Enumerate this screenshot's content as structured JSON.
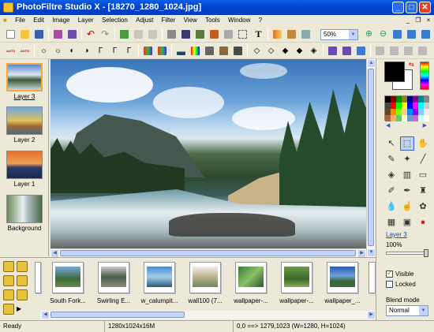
{
  "window": {
    "title": "PhotoFiltre Studio X - [18270_1280_1024.jpg]",
    "controls": {
      "minimize": "_",
      "maximize": "□",
      "close": "✕"
    }
  },
  "menu": [
    "File",
    "Edit",
    "Image",
    "Layer",
    "Selection",
    "Adjust",
    "Filter",
    "View",
    "Tools",
    "Window",
    "?"
  ],
  "toolbar": {
    "zoom_value": "50%",
    "text_tool_label": "T",
    "auto_labels": [
      "AUTO",
      "AUTO"
    ]
  },
  "layers_panel": {
    "items": [
      {
        "label": "Layer 3",
        "active": true
      },
      {
        "label": "Layer 2",
        "active": false
      },
      {
        "label": "Layer 1",
        "active": false
      },
      {
        "label": "Background",
        "active": false
      }
    ]
  },
  "image_canvas": {
    "subject": "mountain river landscape with pine forest"
  },
  "file_browser": {
    "items": [
      {
        "caption": "South Fork..."
      },
      {
        "caption": "Swirling E..."
      },
      {
        "caption": "w_calumpit..."
      },
      {
        "caption": "wall100 (7..."
      },
      {
        "caption": "wallpaper-..."
      },
      {
        "caption": "wallpaper-..."
      },
      {
        "caption": "wallpaper_..."
      }
    ]
  },
  "right_panel": {
    "layer_name": "Layer 3",
    "opacity": "100%",
    "visible_label": "Visible",
    "visible_checked": true,
    "locked_label": "Locked",
    "locked_checked": false,
    "blend_mode_label": "Blend mode",
    "blend_mode_value": "Normal"
  },
  "status": {
    "ready": "Ready",
    "size": "1280x1024x16M",
    "coords": "0,0 ==> 1279,1023 (W=1280, H=1024)"
  },
  "colors": {
    "title_bar": "#0046d5",
    "foreground": "#000000",
    "background": "#ffffff",
    "active_layer_border": "#f2a93b"
  }
}
